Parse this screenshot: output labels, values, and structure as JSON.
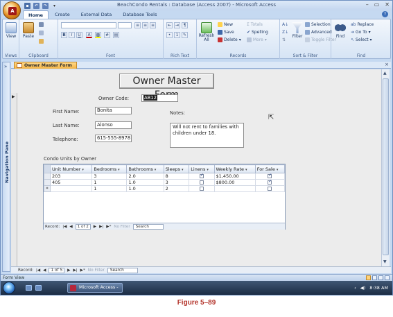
{
  "window": {
    "title": "BeachCondo Rentals : Database (Access 2007) - Microsoft Access",
    "office_button": "A",
    "qat": [
      "save",
      "undo",
      "redo",
      "customize"
    ],
    "controls": [
      "–",
      "▭",
      "✕"
    ]
  },
  "ribbon": {
    "tabs": [
      "Home",
      "Create",
      "External Data",
      "Database Tools"
    ],
    "active_tab": "Home",
    "groups": {
      "views": {
        "caption": "Views",
        "view_label": "View"
      },
      "clipboard": {
        "caption": "Clipboard",
        "paste_label": "Paste"
      },
      "font": {
        "caption": "Font",
        "buttons": [
          "B",
          "I",
          "U"
        ]
      },
      "rich_text": {
        "caption": "Rich Text"
      },
      "records": {
        "caption": "Records",
        "refresh_label": "Refresh All",
        "new_label": "New",
        "save_label": "Save",
        "delete_label": "Delete",
        "totals_label": "Totals",
        "spelling_label": "Spelling",
        "more_label": "More"
      },
      "sort_filter": {
        "caption": "Sort & Filter",
        "filter_label": "Filter",
        "selection_label": "Selection",
        "advanced_label": "Advanced",
        "toggle_label": "Toggle Filter"
      },
      "find": {
        "caption": "Find",
        "find_label": "Find",
        "replace_label": "Replace",
        "goto_label": "Go To",
        "select_label": "Select"
      }
    }
  },
  "nav_pane": {
    "label": "Navigation Pane",
    "chevron": "»"
  },
  "document": {
    "tab_label": "Owner Master Form",
    "close": "×"
  },
  "form": {
    "title": "Owner Master Form",
    "owner_code_label": "Owner Code:",
    "owner_code_value": "AB12",
    "first_name_label": "First Name:",
    "first_name_value": "Bonita",
    "last_name_label": "Last Name:",
    "last_name_value": "Alonso",
    "telephone_label": "Telephone:",
    "telephone_value": "615-555-8978",
    "notes_label": "Notes:",
    "notes_value": "Will not rent to families with children under 18."
  },
  "subform": {
    "caption": "Condo Units by Owner",
    "columns": [
      "Unit Number",
      "Bedrooms",
      "Bathrooms",
      "Sleeps",
      "Linens",
      "Weekly Rate",
      "For Sale"
    ],
    "rows": [
      {
        "unit": "203",
        "bedrooms": "3",
        "bathrooms": "2.0",
        "sleeps": "8",
        "linens": true,
        "rate": "$1,450.00",
        "for_sale": true
      },
      {
        "unit": "405",
        "bedrooms": "1",
        "bathrooms": "1.0",
        "sleeps": "3",
        "linens": false,
        "rate": "$800.00",
        "for_sale": true
      }
    ],
    "new_row": {
      "marker": "*",
      "bedrooms": "1",
      "bathrooms": "1.0",
      "sleeps": "2"
    },
    "nav": {
      "record_label": "Record:",
      "position": "1 of 2",
      "no_filter": "No Filter",
      "search": "Search"
    }
  },
  "record_nav": {
    "record_label": "Record:",
    "position": "1 of 5",
    "no_filter": "No Filter",
    "search": "Search"
  },
  "status_bar": {
    "text": "Form View"
  },
  "taskbar": {
    "task_label": "Microsoft Access - ...",
    "time": "8:38 AM"
  },
  "caption": "Figure 5–89",
  "colors": {
    "accent": "#f5b443",
    "ribbon": "#d6e4f5",
    "caption": "#b3332a"
  }
}
